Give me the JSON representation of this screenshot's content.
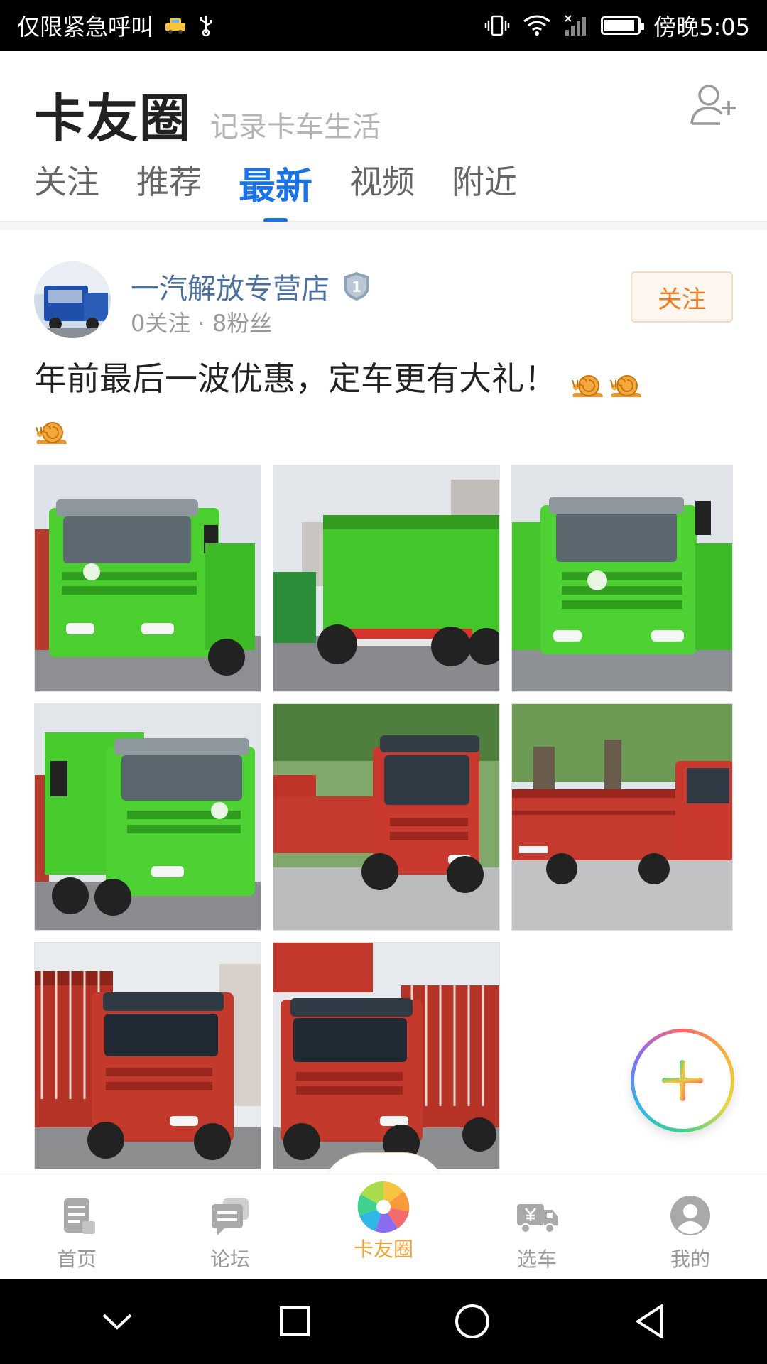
{
  "status_bar": {
    "carrier_text": "仅限紧急呼叫",
    "time": "傍晚5:05"
  },
  "header": {
    "title": "卡友圈",
    "subtitle": "记录卡车生活",
    "add_friend_icon": "add-user-icon",
    "tabs": [
      {
        "label": "关注"
      },
      {
        "label": "推荐"
      },
      {
        "label": "最新",
        "active": true
      },
      {
        "label": "视频"
      },
      {
        "label": "附近"
      }
    ]
  },
  "post": {
    "author": "一汽解放专营店",
    "level": "1",
    "meta": "0关注 · 8粉丝",
    "follow_label": "关注",
    "text": "年前最后一波优惠，定车更有大礼！",
    "emoji_count": 3,
    "photos": [
      {
        "truck": "green dump truck front"
      },
      {
        "truck": "green dump truck rear"
      },
      {
        "truck": "green dump truck front"
      },
      {
        "truck": "green dump truck side"
      },
      {
        "truck": "red cargo truck"
      },
      {
        "truck": "red cargo truck side"
      },
      {
        "truck": "red stake truck"
      },
      {
        "truck": "red stake truck"
      }
    ]
  },
  "fab": {
    "icon": "plus-icon"
  },
  "bottom_nav": {
    "items": [
      {
        "label": "首页",
        "icon": "home-document-icon"
      },
      {
        "label": "论坛",
        "icon": "forum-chat-icon"
      },
      {
        "label": "卡友圈",
        "icon": "pinwheel-icon",
        "active": true
      },
      {
        "label": "选车",
        "icon": "truck-price-icon"
      },
      {
        "label": "我的",
        "icon": "user-profile-icon"
      }
    ]
  },
  "colors": {
    "accent_blue": "#1a73e8",
    "follow_orange": "#f07c1e",
    "active_nav": "#f0a23a",
    "author_blue": "#4a6fa0"
  }
}
